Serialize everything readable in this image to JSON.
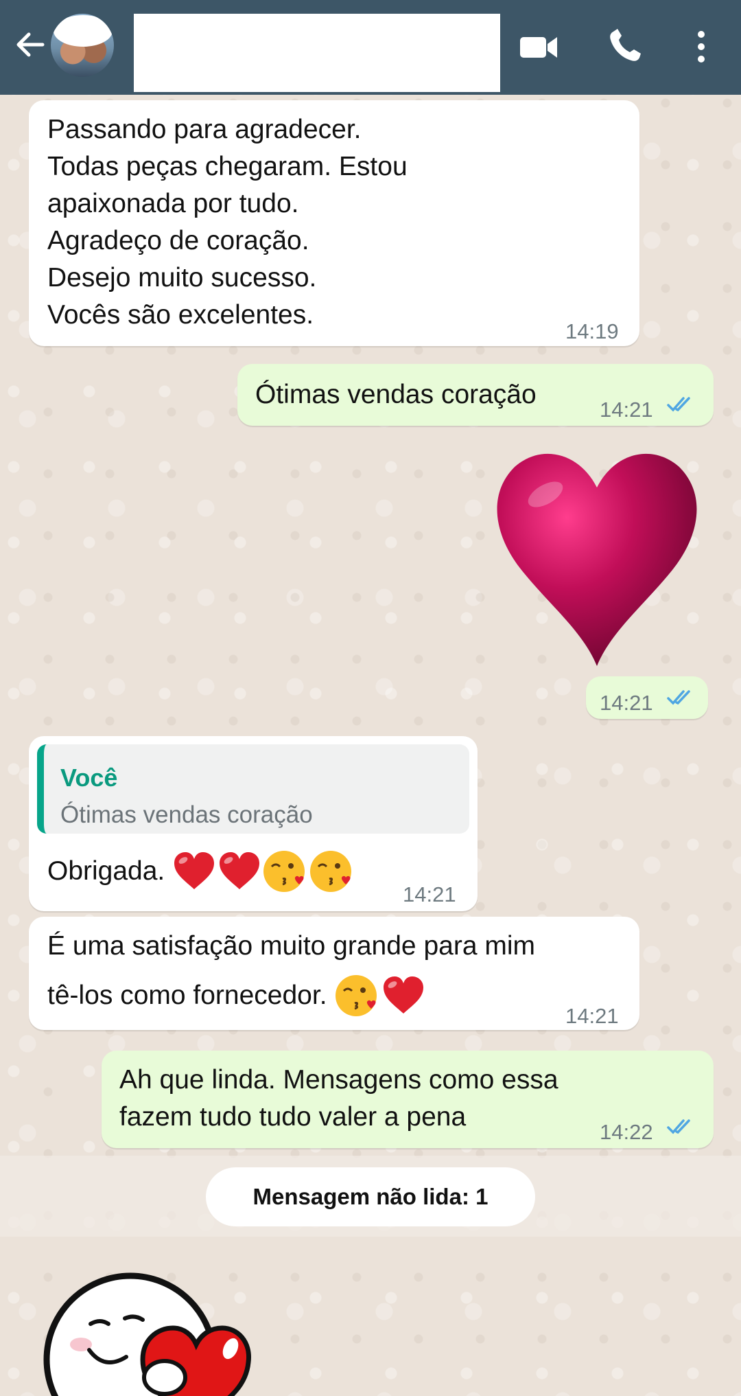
{
  "header": {
    "back_icon": "arrow-left-icon",
    "video_icon": "video-camera-icon",
    "call_icon": "phone-icon",
    "menu_icon": "more-vertical-icon",
    "background_color": "#3d5667"
  },
  "messages": [
    {
      "direction": "in",
      "text": "Passando para agradecer.\nTodas peças chegaram. Estou\napaixonada por tudo.\nAgradeço de coração.\nDesejo muito sucesso.\nVocês são excelentes.",
      "time": "14:19"
    },
    {
      "direction": "out",
      "text": "Ótimas vendas coração",
      "time": "14:21",
      "status": "read"
    },
    {
      "direction": "out",
      "type": "sticker",
      "sticker": "pink-heart-sticker",
      "time": "14:21",
      "status": "read"
    },
    {
      "direction": "in",
      "quote_author": "Você",
      "quote_text": "Ótimas vendas coração",
      "text": "Obrigada.",
      "emojis": [
        "red-heart",
        "red-heart",
        "kissing-face",
        "kissing-face"
      ],
      "time": "14:21"
    },
    {
      "direction": "in",
      "text_line1": "É uma satisfação muito grande para mim",
      "text_line2": "tê-los como fornecedor.",
      "emojis": [
        "kissing-face",
        "red-heart"
      ],
      "time": "14:21"
    },
    {
      "direction": "out",
      "text": "Ah que linda. Mensagens como essa\nfazem tudo tudo valer a pena",
      "time": "14:22",
      "status": "read"
    }
  ],
  "unread_banner": "Mensagem não lida: 1",
  "incoming_sticker": "smiley-holding-heart-sticker",
  "colors": {
    "incoming_bubble": "#ffffff",
    "outgoing_bubble": "#e8fbd8",
    "read_ticks": "#4fa6e2",
    "quote_accent": "#07a58a"
  }
}
